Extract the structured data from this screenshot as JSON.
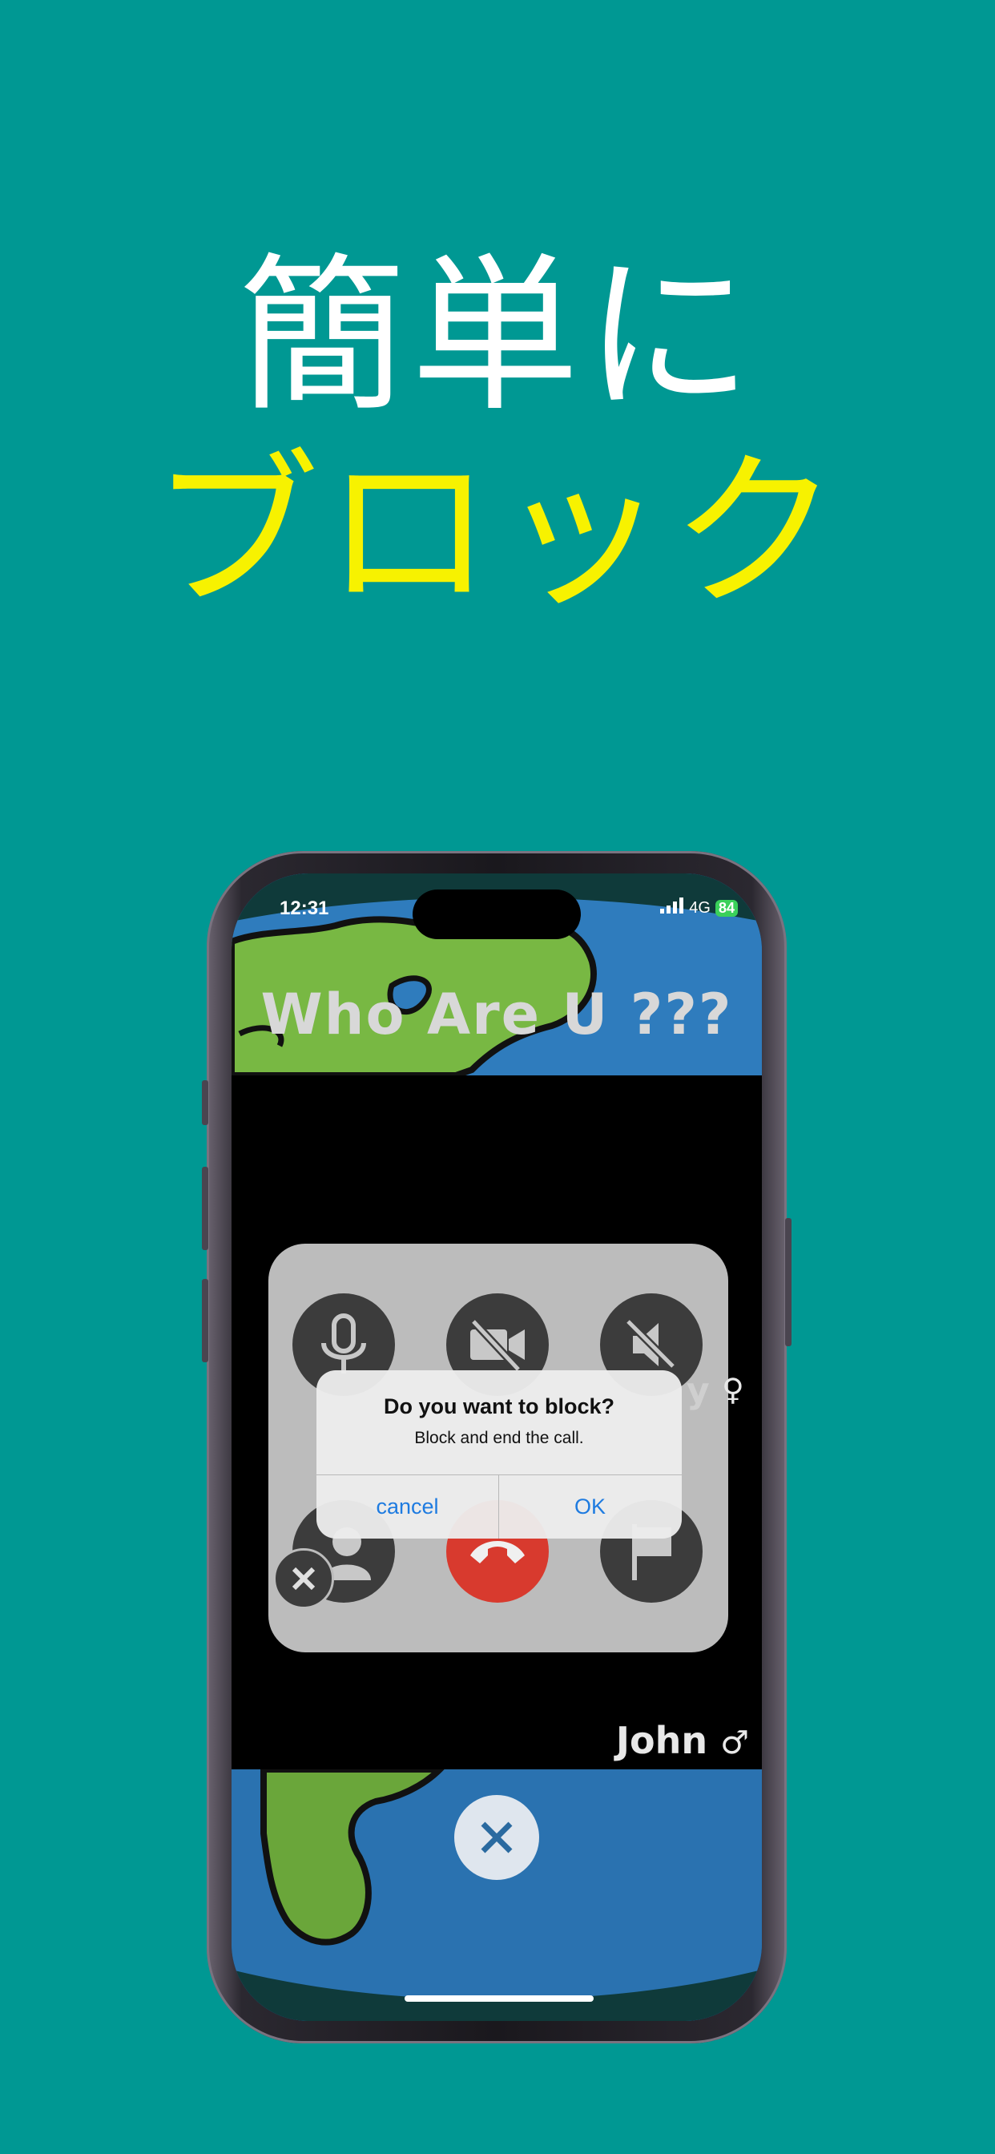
{
  "headline": {
    "line1": "簡単に",
    "line2": "ブロック"
  },
  "colors": {
    "background": "#009893",
    "headline_line1": "#ffffff",
    "headline_line2": "#f7f200",
    "alert_button": "#1e7be0",
    "end_call": "#d83a2e"
  },
  "status_bar": {
    "time": "12:31",
    "network": "4G",
    "battery": "84"
  },
  "app": {
    "title": "Who Are U ???",
    "remote_user_fragment": "y",
    "remote_user_gender_symbol": "♀",
    "local_user_name": "John",
    "local_user_gender_symbol": "♂"
  },
  "controls": {
    "icons": [
      "microphone-icon",
      "video-off-icon",
      "speaker-mute-icon",
      "block-user-icon",
      "end-call-icon",
      "report-flag-icon"
    ]
  },
  "alert": {
    "title": "Do you want to block?",
    "message": "Block and end the call.",
    "cancel_label": "cancel",
    "ok_label": "OK"
  }
}
